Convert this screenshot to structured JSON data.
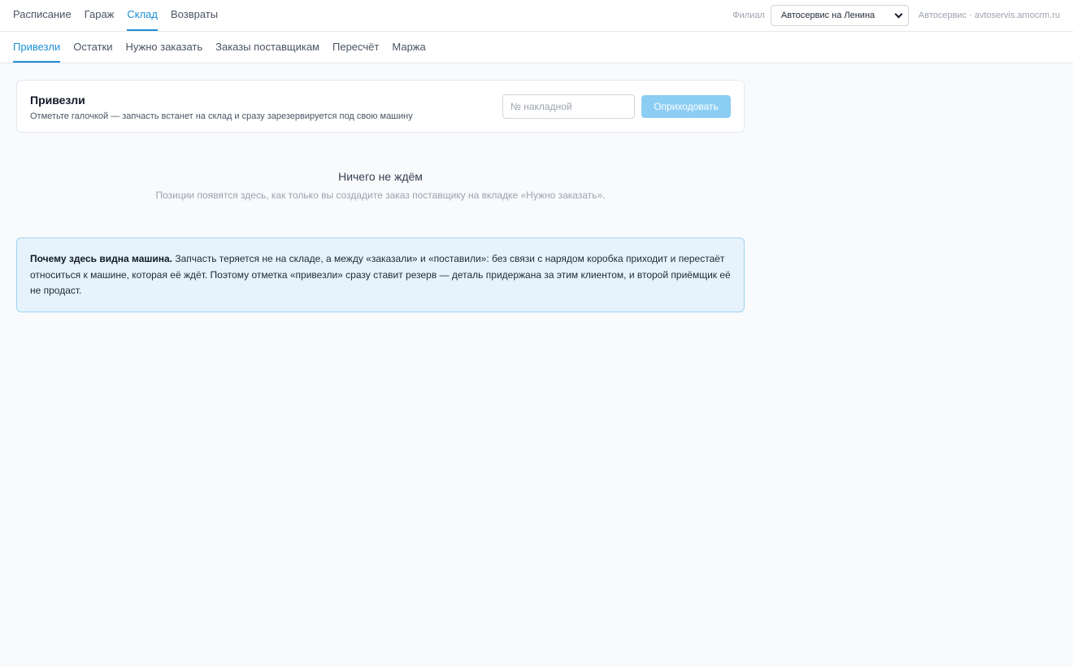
{
  "topnav": {
    "items": [
      {
        "label": "Расписание",
        "active": false
      },
      {
        "label": "Гараж",
        "active": false
      },
      {
        "label": "Склад",
        "active": true
      },
      {
        "label": "Возвраты",
        "active": false
      }
    ]
  },
  "branch": {
    "label": "Филиал",
    "selected": "Автосервис на Ленина"
  },
  "account": "Автосервис · avtoservis.amocrm.ru",
  "subtabs": [
    {
      "label": "Привезли",
      "active": true
    },
    {
      "label": "Остатки",
      "active": false
    },
    {
      "label": "Нужно заказать",
      "active": false
    },
    {
      "label": "Заказы поставщикам",
      "active": false
    },
    {
      "label": "Пересчёт",
      "active": false
    },
    {
      "label": "Маржа",
      "active": false
    }
  ],
  "receive_card": {
    "title": "Привезли",
    "subtitle": "Отметьте галочкой — запчасть встанет на склад и сразу зарезервируется под свою машину",
    "invoice_placeholder": "№ накладной",
    "invoice_value": "",
    "button_label": "Оприходовать"
  },
  "empty_state": {
    "title": "Ничего не ждём",
    "subtitle": "Позиции появятся здесь, как только вы создадите заказ поставщику на вкладке «Нужно заказать»."
  },
  "notice": {
    "lead": "Почему здесь видна машина.",
    "body": " Запчасть теряется не на складе, а между «заказали» и «поставили»: без связи с нарядом коробка приходит и перестаёт относиться к машине, которая её ждёт. Поэтому отметка «привезли» сразу ставит резерв — деталь придержана за этим клиентом, и второй приёмщик её не продаст."
  },
  "colors": {
    "accent": "#1d8fd6",
    "button_disabled": "#8ccdf3",
    "notice_bg": "#e6f3fc",
    "notice_border": "#9fd2f2"
  }
}
